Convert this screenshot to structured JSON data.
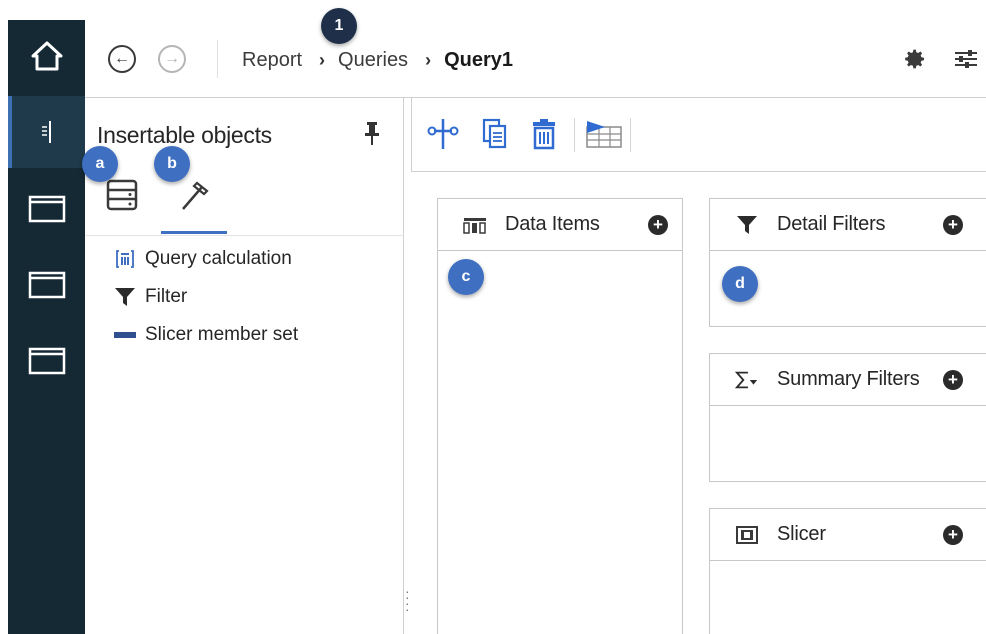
{
  "header": {
    "breadcrumbs": [
      "Report",
      "Queries",
      "Query1"
    ],
    "back_icon": "arrow-left-circle-icon",
    "forward_icon": "arrow-right-circle-icon",
    "settings_icon": "gear-icon",
    "properties_icon": "sliders-icon"
  },
  "rail": {
    "items": [
      {
        "icon": "home-icon"
      },
      {
        "icon": "report-outline-icon",
        "active": true
      },
      {
        "icon": "folder-icon"
      },
      {
        "icon": "folder-icon"
      },
      {
        "icon": "folder-icon"
      }
    ]
  },
  "insertable_panel": {
    "title": "Insertable objects",
    "tabs": [
      {
        "icon": "data-source-icon"
      },
      {
        "icon": "toolbox-hammer-icon",
        "selected": true
      }
    ],
    "objects": [
      {
        "label": "Query calculation",
        "icon": "query-calculation-icon"
      },
      {
        "label": "Filter",
        "icon": "filter-icon"
      },
      {
        "label": "Slicer member set",
        "icon": "slicer-member-set-icon"
      }
    ]
  },
  "toolbar": {
    "icons": [
      "cut-icon",
      "copy-icon",
      "delete-icon",
      "view-tabular-data-icon"
    ]
  },
  "zones": {
    "data_items": {
      "title": "Data Items"
    },
    "detail_filters": {
      "title": "Detail Filters"
    },
    "summary_filters": {
      "title": "Summary Filters"
    },
    "slicer": {
      "title": "Slicer"
    }
  },
  "callouts": {
    "one": "1",
    "a": "a",
    "b": "b",
    "c": "c",
    "d": "d"
  },
  "colors": {
    "rail_bg": "#152935",
    "accent": "#3e6fc0",
    "callout_dark": "#1f2f4a"
  }
}
